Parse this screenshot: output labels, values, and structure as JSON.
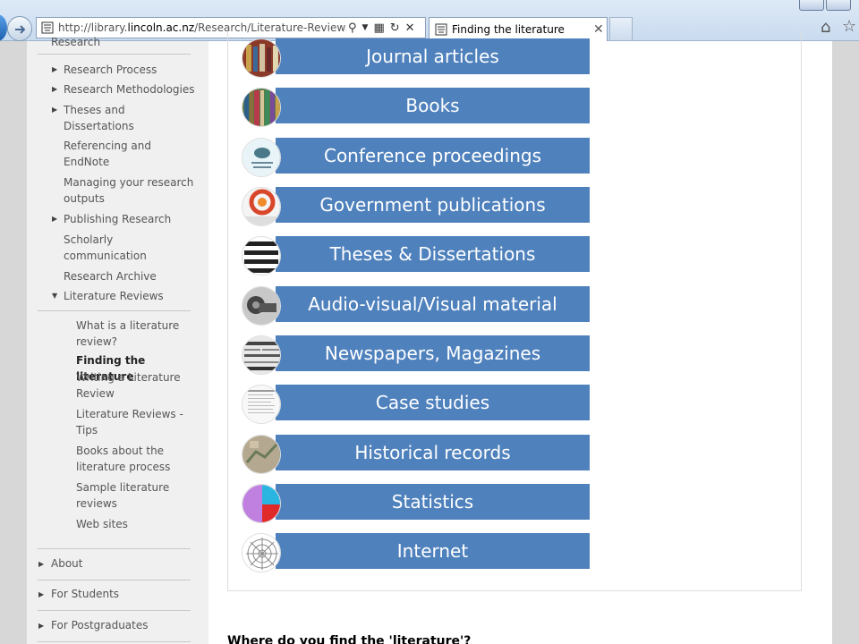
{
  "browser": {
    "url_prefix": "http://library.",
    "url_domain": "lincoln.ac.nz",
    "url_path": "/Research/Literature-Reviews/Findi",
    "tab_title": "Finding the literature"
  },
  "sidebar": {
    "partial_top": "Research",
    "items": [
      {
        "label": "Research Process",
        "arrow": "▶"
      },
      {
        "label": "Research Methodologies",
        "arrow": "▶"
      },
      {
        "label": "Theses and Dissertations",
        "arrow": "▶"
      },
      {
        "label": "Referencing and EndNote",
        "arrow": ""
      },
      {
        "label": "Managing your research outputs",
        "arrow": ""
      },
      {
        "label": "Publishing Research",
        "arrow": "▶"
      },
      {
        "label": "Scholarly communication",
        "arrow": ""
      },
      {
        "label": "Research Archive",
        "arrow": ""
      },
      {
        "label": "Literature Reviews",
        "arrow": "▼"
      }
    ],
    "subitems": [
      {
        "label": "What is a literature review?"
      },
      {
        "label": "Finding the literature"
      },
      {
        "label": "Writing a Literature Review"
      },
      {
        "label": "Literature Reviews - Tips"
      },
      {
        "label": "Books about the literature process"
      },
      {
        "label": "Sample literature reviews"
      },
      {
        "label": "Web sites"
      }
    ],
    "top_items": [
      {
        "label": "About"
      },
      {
        "label": "For Students"
      },
      {
        "label": "For Postgraduates"
      }
    ]
  },
  "sources": [
    {
      "label": "Journal articles",
      "thumb_color": "#8b3a2a"
    },
    {
      "label": "Books",
      "thumb_color": "#5a7a4a"
    },
    {
      "label": "Conference proceedings",
      "thumb_color": "#e8f4f8"
    },
    {
      "label": "Government publications",
      "thumb_color": "#d9472b"
    },
    {
      "label": "Theses & Dissertations",
      "thumb_color": "#ffffff"
    },
    {
      "label": "Audio-visual/Visual material",
      "thumb_color": "#555555"
    },
    {
      "label": "Newspapers, Magazines",
      "thumb_color": "#bbbbbb"
    },
    {
      "label": "Case studies",
      "thumb_color": "#f4f4f4"
    },
    {
      "label": "Historical records",
      "thumb_color": "#b5a890"
    },
    {
      "label": "Statistics",
      "thumb_color": "#c080e0"
    },
    {
      "label": "Internet",
      "thumb_color": "#ffffff"
    }
  ],
  "main": {
    "heading2": "Where do you find the 'literature'?"
  },
  "colors": {
    "button_blue": "#4f81bd"
  }
}
